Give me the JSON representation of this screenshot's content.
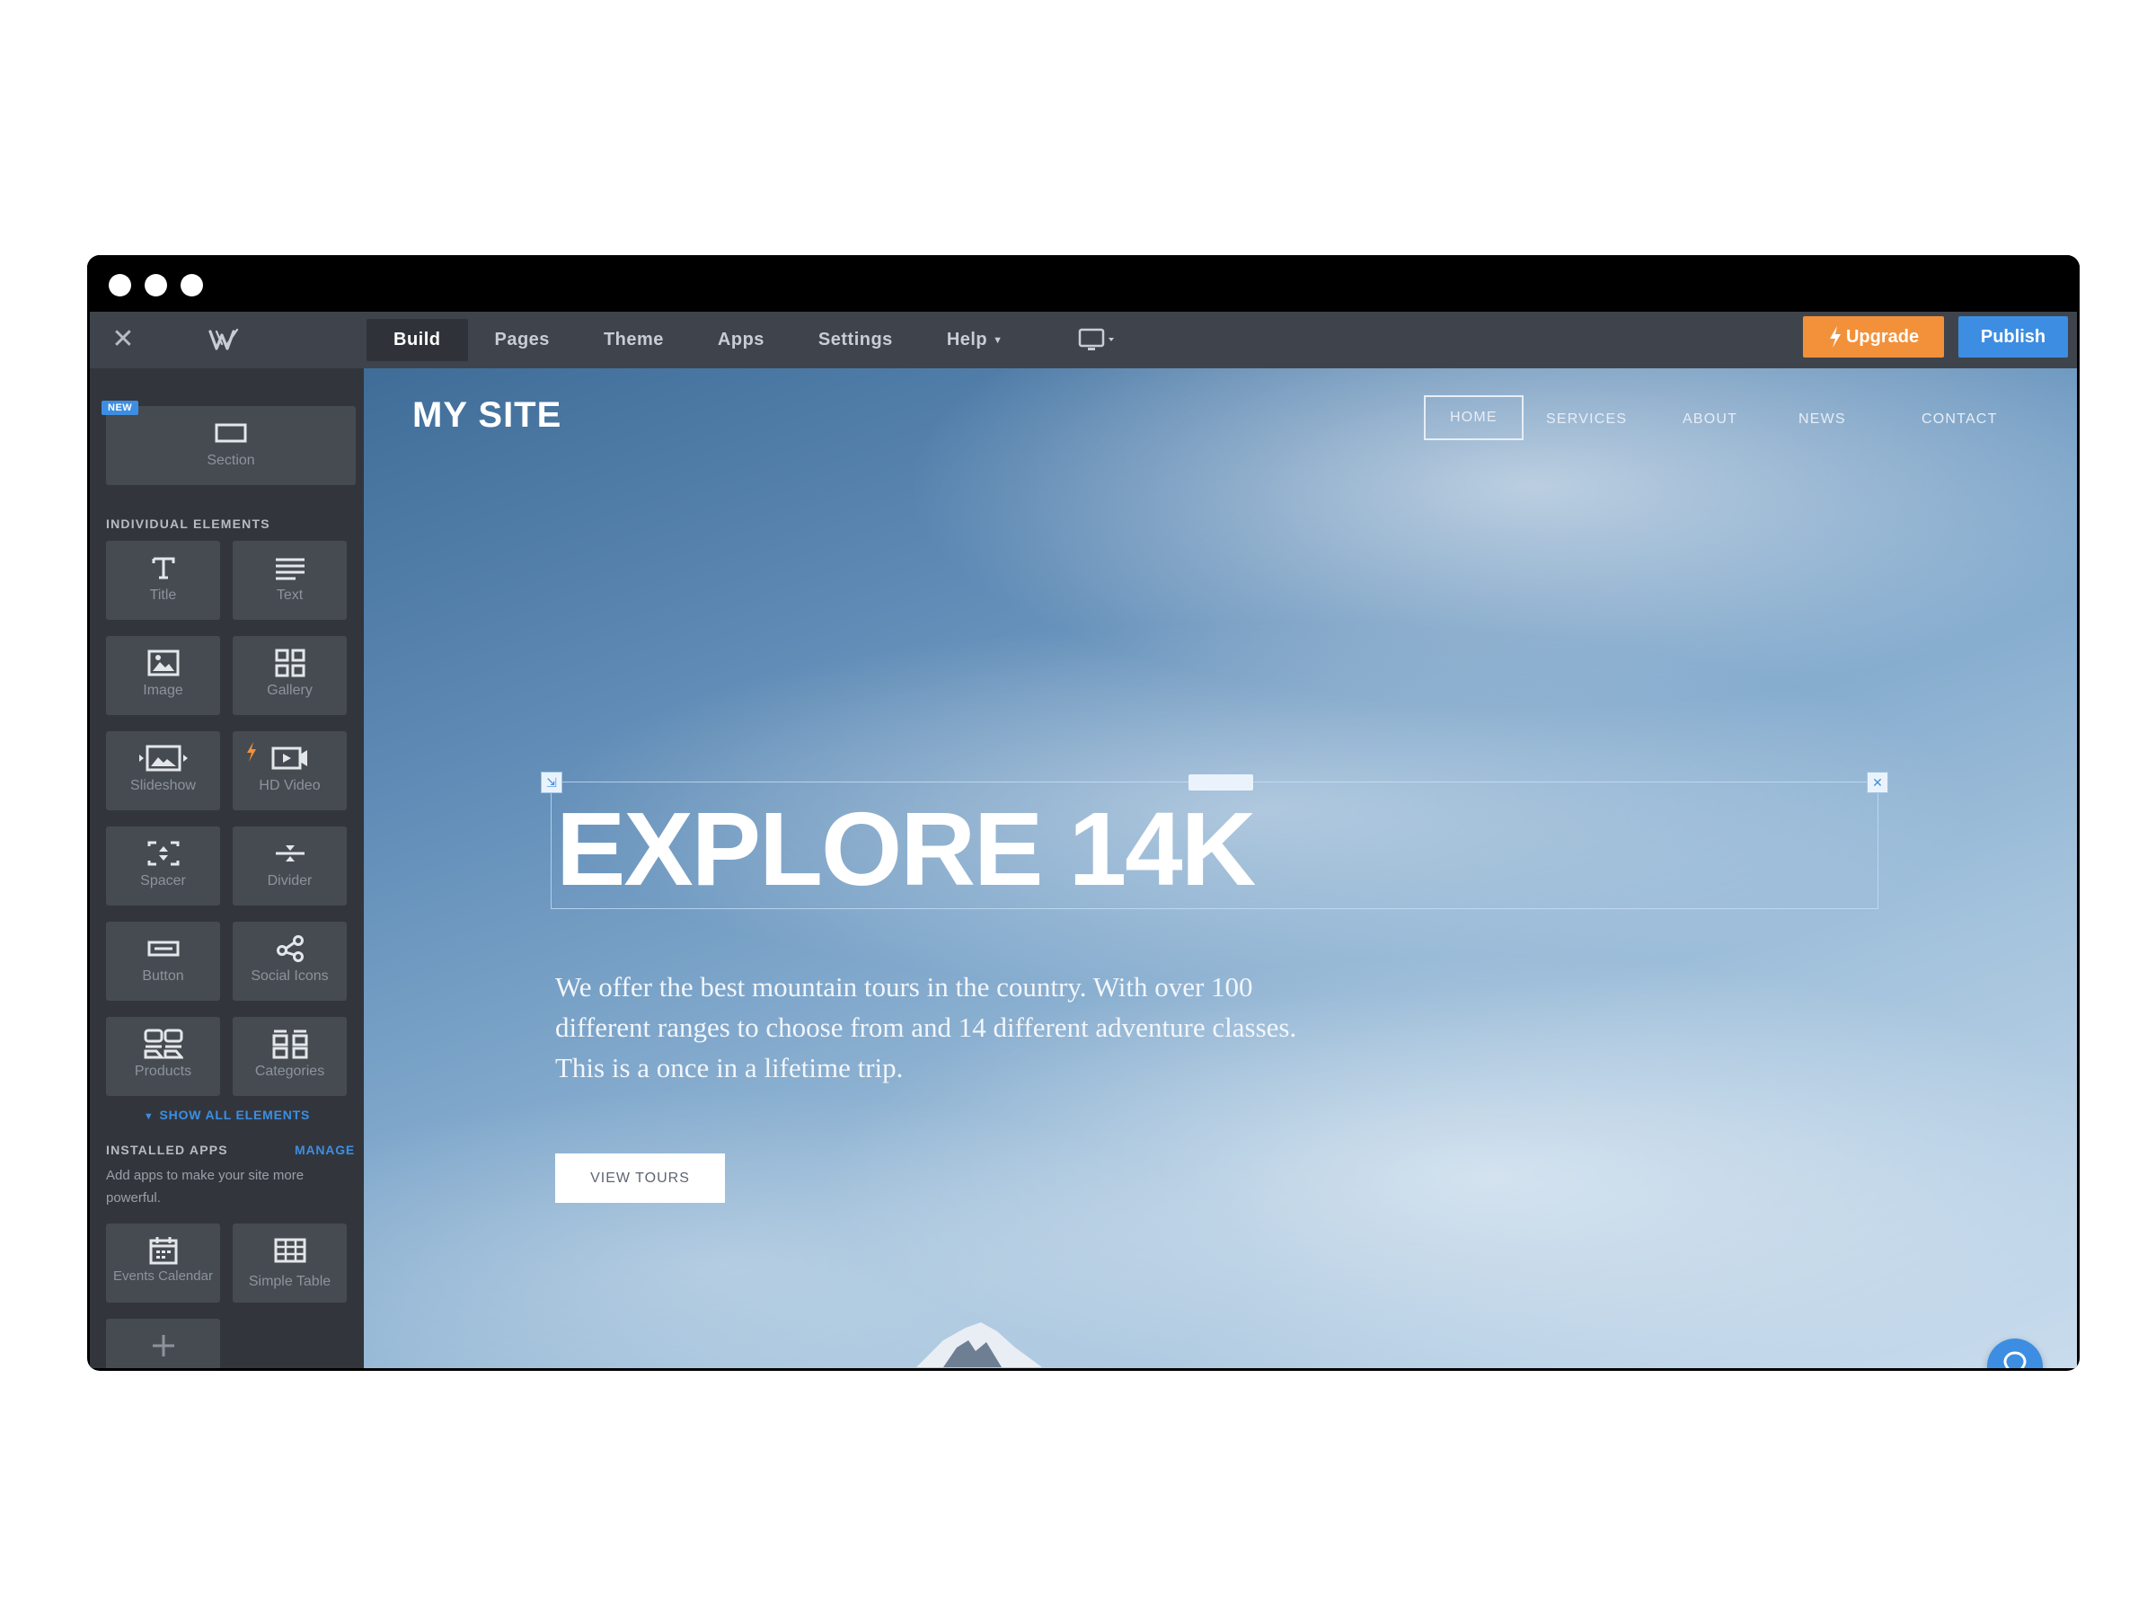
{
  "toolbar": {
    "tabs": [
      {
        "label": "Build",
        "active": true
      },
      {
        "label": "Pages"
      },
      {
        "label": "Theme"
      },
      {
        "label": "Apps"
      },
      {
        "label": "Settings"
      },
      {
        "label": "Help",
        "has_dropdown": true
      }
    ],
    "upgrade_label": "Upgrade",
    "publish_label": "Publish",
    "colors": {
      "upgrade": "#f2913a",
      "publish": "#3d8ee2"
    }
  },
  "sidebar": {
    "new_badge": "NEW",
    "section_label": "Section",
    "individual_heading": "INDIVIDUAL ELEMENTS",
    "elements": [
      {
        "label": "Title",
        "icon": "title-icon"
      },
      {
        "label": "Text",
        "icon": "text-lines-icon"
      },
      {
        "label": "Image",
        "icon": "image-icon"
      },
      {
        "label": "Gallery",
        "icon": "gallery-grid-icon"
      },
      {
        "label": "Slideshow",
        "icon": "slideshow-icon"
      },
      {
        "label": "HD Video",
        "icon": "video-icon",
        "premium": true
      },
      {
        "label": "Spacer",
        "icon": "spacer-icon"
      },
      {
        "label": "Divider",
        "icon": "divider-icon"
      },
      {
        "label": "Button",
        "icon": "button-icon"
      },
      {
        "label": "Social Icons",
        "icon": "share-icon"
      },
      {
        "label": "Products",
        "icon": "products-icon"
      },
      {
        "label": "Categories",
        "icon": "categories-icon"
      }
    ],
    "show_all": "SHOW ALL ELEMENTS",
    "installed_heading": "INSTALLED APPS",
    "manage_label": "MANAGE",
    "apps_description": "Add apps to make your site more powerful.",
    "apps": [
      {
        "label": "Events Calendar",
        "icon": "calendar-icon"
      },
      {
        "label": "Simple Table",
        "icon": "table-icon"
      }
    ]
  },
  "site": {
    "logo": "MY SITE",
    "nav": [
      {
        "label": "HOME",
        "active": true
      },
      {
        "label": "SERVICES"
      },
      {
        "label": "ABOUT"
      },
      {
        "label": "NEWS"
      },
      {
        "label": "CONTACT"
      }
    ],
    "hero_title": "EXPLORE 14K",
    "hero_text": "We offer the best mountain tours in the country. With over 100 different ranges to choose from and 14 different adventure classes. This is a once in a lifetime trip.",
    "hero_button": "VIEW TOURS"
  }
}
